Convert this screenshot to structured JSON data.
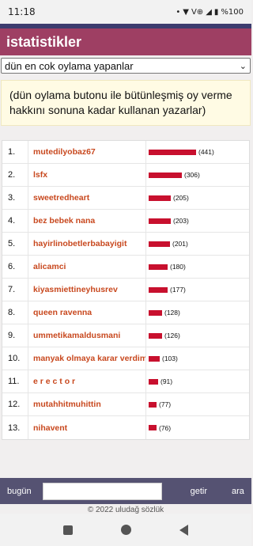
{
  "status": {
    "time": "11:18",
    "icons_text": "• ⋄Vo ◢ ▮%100",
    "battery": "%100"
  },
  "header": {
    "title": "istatistikler"
  },
  "select": {
    "value": "dün en cok oylama yapanlar"
  },
  "info": {
    "text": "(dün oylama butonu ile bütünleşmiş oy verme hakkını sonuna kadar kullanan yazarlar)"
  },
  "ranking": {
    "max_value": 441,
    "rows": [
      {
        "rank": "1.",
        "name": "mutedilyobaz67",
        "count_label": "(441)",
        "value": 441
      },
      {
        "rank": "2.",
        "name": "lsfx",
        "count_label": "(306)",
        "value": 306
      },
      {
        "rank": "3.",
        "name": "sweetredheart",
        "count_label": "(205)",
        "value": 205
      },
      {
        "rank": "4.",
        "name": "bez bebek nana",
        "count_label": "(203)",
        "value": 203
      },
      {
        "rank": "5.",
        "name": "hayirlinobetlerbabayigit",
        "count_label": "(201)",
        "value": 201
      },
      {
        "rank": "6.",
        "name": "alicamci",
        "count_label": "(180)",
        "value": 180
      },
      {
        "rank": "7.",
        "name": "kiyasmiettineyhusrev",
        "count_label": "(177)",
        "value": 177
      },
      {
        "rank": "8.",
        "name": "queen ravenna",
        "count_label": "(128)",
        "value": 128
      },
      {
        "rank": "9.",
        "name": "ummetikamaldusmani",
        "count_label": "(126)",
        "value": 126
      },
      {
        "rank": "10.",
        "name": "manyak olmaya karar verdim",
        "count_label": "(103)",
        "value": 103
      },
      {
        "rank": "11.",
        "name": "e r e c t o r",
        "count_label": "(91)",
        "value": 91
      },
      {
        "rank": "12.",
        "name": "mutahhitmuhittin",
        "count_label": "(77)",
        "value": 77
      },
      {
        "rank": "13.",
        "name": "nihavent",
        "count_label": "(76)",
        "value": 76
      }
    ]
  },
  "bottom": {
    "today_label": "bugün",
    "input_value": "",
    "getir_label": "getir",
    "ara_label": "ara"
  },
  "footer": {
    "text": "© 2022 uludağ sözlük"
  },
  "colors": {
    "header_bg": "#9e3f63",
    "name_color": "#c8481e",
    "bar_color": "#c8102e",
    "bottom_bar_bg": "#555272"
  }
}
